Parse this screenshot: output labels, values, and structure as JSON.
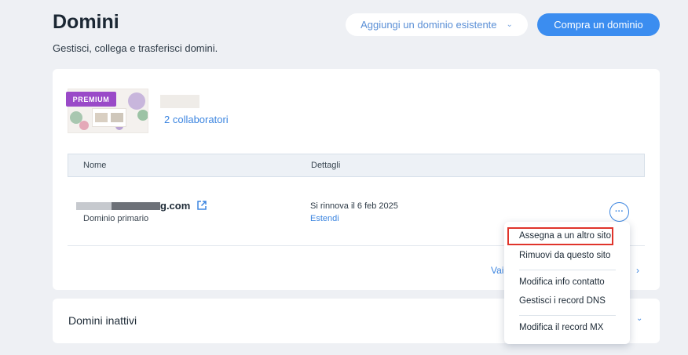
{
  "header": {
    "title": "Domini",
    "subtitle": "Gestisci, collega e trasferisci domini.",
    "add_existing_label": "Aggiungi un dominio esistente",
    "buy_label": "Compra un dominio"
  },
  "site": {
    "badge": "PREMIUM",
    "collaborators_label": "2 collaboratori"
  },
  "table": {
    "columns": [
      "Nome",
      "Dettagli"
    ],
    "rows": [
      {
        "domain_visible_suffix": "g.com",
        "domain_type": "Dominio primario",
        "renewal_text": "Si rinnova il 6 feb 2025",
        "extend_label": "Estendi"
      }
    ],
    "bottom_link": "Vai"
  },
  "inactive": {
    "title": "Domini inattivi"
  },
  "context_menu": {
    "items": [
      "Assegna a un altro sito",
      "Rimuovi da questo sito",
      "Modifica info contatto",
      "Gestisci i record DNS",
      "Modifica il record MX"
    ]
  },
  "icons": {
    "external": "external-link-icon",
    "more": "more-horizontal-icon",
    "chevron": "chevron-down-icon"
  },
  "colors": {
    "accent": "#3b8df0",
    "premium": "#9a4ac8",
    "highlight": "#e0342b",
    "background": "#eef0f4"
  }
}
